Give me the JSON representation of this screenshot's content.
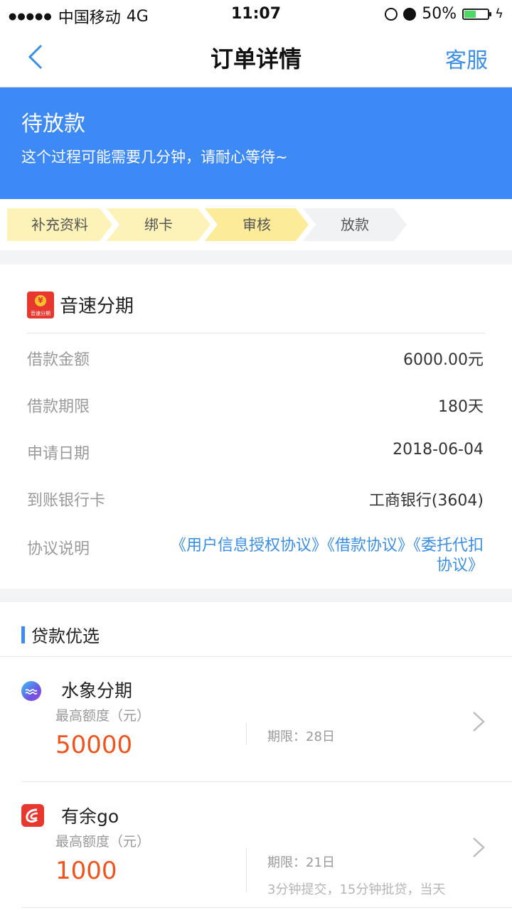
{
  "status_bar": {
    "carrier": "中国移动",
    "network": "4G",
    "time": "11:07",
    "battery_text": "50%",
    "battery_level": 0.5,
    "icons": [
      "signal-dots-icon",
      "rotation-lock-icon",
      "alarm-icon",
      "battery-icon",
      "charging-bolt-icon"
    ]
  },
  "nav": {
    "back_icon": "chevron-left-icon",
    "title": "订单详情",
    "service_label": "客服"
  },
  "banner": {
    "title": "待放款",
    "description": "这个过程可能需要几分钟，请耐心等待~",
    "color": "#3d8af7"
  },
  "steps": [
    {
      "label": "补充资料",
      "status": "done",
      "color": "#fdf3b8"
    },
    {
      "label": "绑卡",
      "status": "done",
      "color": "#fdf3b8"
    },
    {
      "label": "审核",
      "status": "current",
      "color": "#fcec9a"
    },
    {
      "label": "放款",
      "status": "pending",
      "color": "#f1f2f4"
    }
  ],
  "order": {
    "app_name": "音速分期",
    "app_logo": {
      "coin": "¥",
      "text": "音速分期"
    },
    "rows": [
      {
        "label": "借款金额",
        "value": "6000.00元"
      },
      {
        "label": "借款期限",
        "value": "180天"
      },
      {
        "label": "申请日期",
        "value": "2018-06-04"
      },
      {
        "label": "到账银行卡",
        "value": "工商银行(3604)"
      }
    ],
    "agreement_label": "协议说明",
    "agreements": [
      "《用户信息授权协议》",
      "《借款协议》",
      "《委托代扣协议》"
    ]
  },
  "loans": {
    "section_title": "贷款优选",
    "items": [
      {
        "name": "水象分期",
        "icon": "water-wave-icon",
        "quota_label": "最高额度（元）",
        "quota": "50000",
        "term": "期限：28日",
        "desc": ""
      },
      {
        "name": "有余go",
        "icon": "youyu-logo-icon",
        "quota_label": "最高额度（元）",
        "quota": "1000",
        "term": "期限：21日",
        "desc": "3分钟提交，15分钟批贷，当天"
      }
    ]
  },
  "colors": {
    "accent": "#3a8ee6",
    "quota": "#f0531c"
  }
}
